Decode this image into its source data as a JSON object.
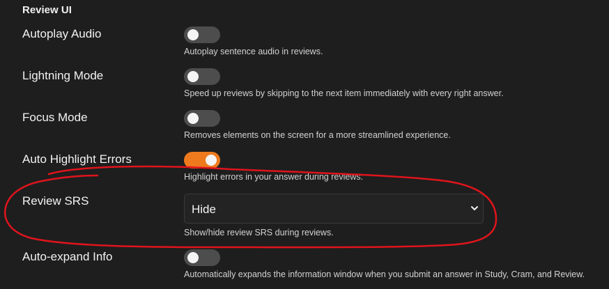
{
  "section": {
    "title": "Review UI"
  },
  "settings": [
    {
      "label": "Autoplay Audio",
      "description": "Autoplay sentence audio in reviews.",
      "enabled": false
    },
    {
      "label": "Lightning Mode",
      "description": "Speed up reviews by skipping to the next item immediately with every right answer.",
      "enabled": false
    },
    {
      "label": "Focus Mode",
      "description": "Removes elements on the screen for a more streamlined experience.",
      "enabled": false
    },
    {
      "label": "Auto Highlight Errors",
      "description": "Highlight errors in your answer during reviews.",
      "enabled": true
    },
    {
      "label": "Review SRS",
      "description": "Show/hide review SRS during reviews.",
      "selected": "Hide"
    },
    {
      "label": "Auto-expand Info",
      "description": "Automatically expands the information window when you submit an answer in Study, Cram, and Review.",
      "enabled": false
    }
  ],
  "colors": {
    "background": "#1e1e1e",
    "toggle_off": "#4d4d4d",
    "toggle_on": "#ee7a1d",
    "annotation": "#e0141c"
  },
  "icons": {
    "select_arrow": "chevron-down-icon"
  }
}
